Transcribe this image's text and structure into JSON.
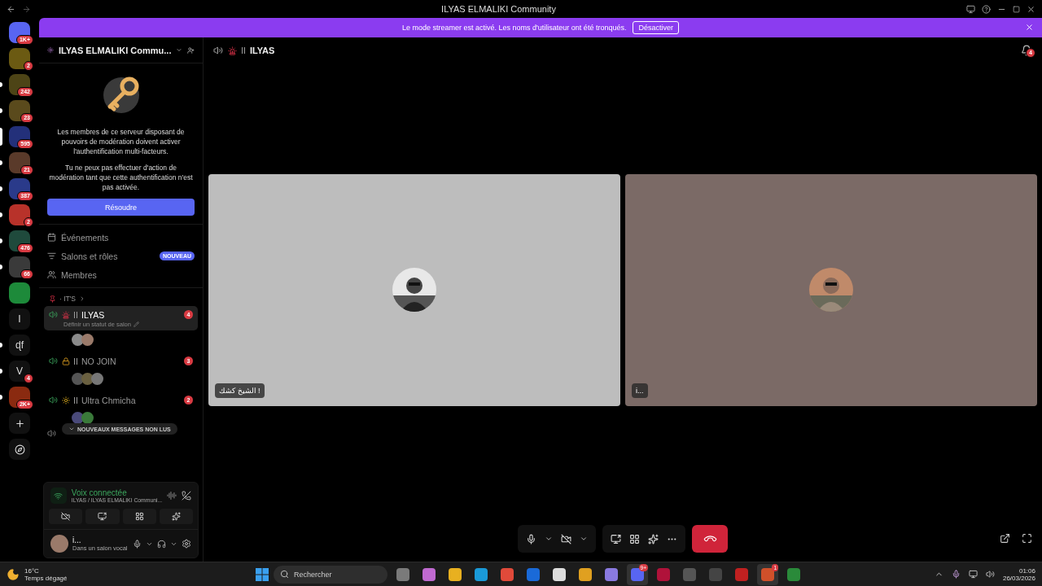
{
  "window": {
    "title": "ILYAS ELMALIKI Community"
  },
  "banner": {
    "text": "Le mode streamer est activé. Les noms d'utilisateur ont été tronqués.",
    "button": "Désactiver"
  },
  "servers": [
    {
      "kind": "avatar",
      "color": "#5865f2",
      "badge": "1K+",
      "selected": false,
      "unread": false
    },
    {
      "kind": "avatar",
      "color": "#6b5a12",
      "badge": "2",
      "selected": false,
      "unread": false
    },
    {
      "kind": "avatar",
      "color": "#4d4416",
      "badge": "242",
      "selected": false,
      "unread": true
    },
    {
      "kind": "avatar",
      "color": "#5a4a1c",
      "badge": "23",
      "selected": false,
      "unread": true
    },
    {
      "kind": "avatar",
      "color": "#23307a",
      "badge": "595",
      "selected": true,
      "unread": false
    },
    {
      "kind": "avatar",
      "color": "#5a3a2a",
      "badge": "21",
      "selected": false,
      "unread": true
    },
    {
      "kind": "avatar",
      "color": "#2a3a8a",
      "badge": "387",
      "selected": false,
      "unread": true
    },
    {
      "kind": "avatar",
      "color": "#b8322a",
      "badge": "2",
      "selected": false,
      "unread": true
    },
    {
      "kind": "avatar",
      "color": "#1f4a3c",
      "badge": "476",
      "selected": false,
      "unread": true
    },
    {
      "kind": "avatar",
      "color": "#3a3a3a",
      "badge": "66",
      "selected": false,
      "unread": true
    },
    {
      "kind": "avatar",
      "color": "#1d8a3a",
      "selected": false,
      "unread": false
    },
    {
      "kind": "letter",
      "letter": "I",
      "selected": false,
      "unread": false
    },
    {
      "kind": "letter",
      "letter": "ɖf",
      "selected": false,
      "unread": true
    },
    {
      "kind": "letter",
      "letter": "V",
      "badge": "4",
      "selected": false,
      "unread": true
    },
    {
      "kind": "avatar",
      "color": "#8a2a10",
      "badge": "2K+",
      "selected": false,
      "unread": true
    },
    {
      "kind": "add",
      "selected": false,
      "unread": false
    },
    {
      "kind": "explore",
      "selected": false,
      "unread": false
    }
  ],
  "sidebar": {
    "server_name": "ILYAS ELMALIKI Commu...",
    "notice": {
      "paragraphs": [
        "Les membres de ce serveur disposant de pouvoirs de modération doivent activer l'authentification multi-facteurs.",
        "Tu ne peux pas effectuer d'action de modération tant que cette authentification n'est pas activée."
      ],
      "button": "Résoudre"
    },
    "nav": [
      {
        "kind": "events",
        "label": "Événements"
      },
      {
        "kind": "channels",
        "label": "Salons et rôles",
        "badge": "NOUVEAU"
      },
      {
        "kind": "members",
        "label": "Membres"
      }
    ],
    "category": "· IT'S",
    "channels": [
      {
        "kind": "siren",
        "name": "ILYAS",
        "badge": "4",
        "selected": true,
        "status": "Définir un statut de salon",
        "participants": [
          {
            "color": "#8a8a8a"
          },
          {
            "color": "#9a7a6a"
          }
        ]
      },
      {
        "kind": "lock",
        "name": "NO JOIN",
        "badge": "3",
        "selected": false,
        "participants": [
          {
            "color": "#555555"
          },
          {
            "color": "#6a6040"
          },
          {
            "color": "#777777"
          }
        ]
      },
      {
        "kind": "sun",
        "name": "Ultra Chmicha",
        "badge": "2",
        "selected": false,
        "participants": [
          {
            "color": "#4a4a7a"
          },
          {
            "color": "#3a7a3a"
          }
        ]
      }
    ],
    "unread_pill": "NOUVEAUX MESSAGES NON LUS",
    "voice": {
      "status": "Voix connectée",
      "channel": "ILYAS / ILYAS ELMALIKI Communi..."
    },
    "user": {
      "name": "i...",
      "status": "Dans un salon vocal"
    }
  },
  "call": {
    "channel": "ILYAS",
    "inbox_badge": "4",
    "tiles": [
      {
        "label": "الشيخ كشك !",
        "color": "#bdbdbd"
      },
      {
        "label": "i...",
        "color": "#7b6a66"
      }
    ]
  },
  "taskbar": {
    "weather": {
      "temp": "16°C",
      "desc": "Temps dégagé"
    },
    "search": "Rechercher",
    "apps": [
      {
        "color": "#7a7a7a",
        "selected": false
      },
      {
        "color": "#c06ad0",
        "selected": false
      },
      {
        "color": "#e8b020",
        "selected": false
      },
      {
        "color": "#1a9ad8",
        "selected": false
      },
      {
        "color": "#e04a3a",
        "selected": false
      },
      {
        "color": "#1a6ad8",
        "selected": false
      },
      {
        "color": "#dddddd",
        "selected": false
      },
      {
        "color": "#e0a020",
        "selected": false
      },
      {
        "color": "#8a7ae0",
        "selected": false
      },
      {
        "color": "#5865f2",
        "badge": "9+",
        "selected": true
      },
      {
        "color": "#b0123a",
        "selected": false
      },
      {
        "color": "#555555",
        "selected": false
      },
      {
        "color": "#444444",
        "selected": false
      },
      {
        "color": "#c02020",
        "selected": false
      },
      {
        "color": "#d0502a",
        "badge": "1",
        "selected": true
      },
      {
        "color": "#2a8a3a",
        "selected": false
      }
    ],
    "time": "01:06",
    "date": "26/03/2026"
  }
}
